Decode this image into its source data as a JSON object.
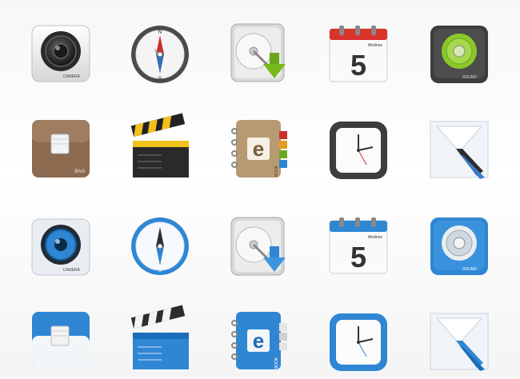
{
  "icon_grid": {
    "rows": [
      {
        "theme": "classic",
        "accent": "#79b81c",
        "camera_label": "CAMERA",
        "compass_north": "N",
        "compass_south": "S",
        "calendar_day": "Wednes",
        "calendar_number": "5",
        "speaker_label": "SOUND",
        "bag_label": "BAG",
        "book_letter": "e",
        "book_label": "BOOK"
      },
      {
        "theme": "classic-2",
        "accent": "#c9a23a"
      },
      {
        "theme": "blue",
        "accent": "#2f86d3",
        "camera_label": "CAMERA",
        "compass_north": "N",
        "compass_south": "S",
        "calendar_day": "Wednes",
        "calendar_number": "5",
        "speaker_label": "SOUND",
        "book_letter": "e",
        "book_label": "BOOK"
      },
      {
        "theme": "blue-2",
        "accent": "#2f86d3"
      }
    ]
  }
}
